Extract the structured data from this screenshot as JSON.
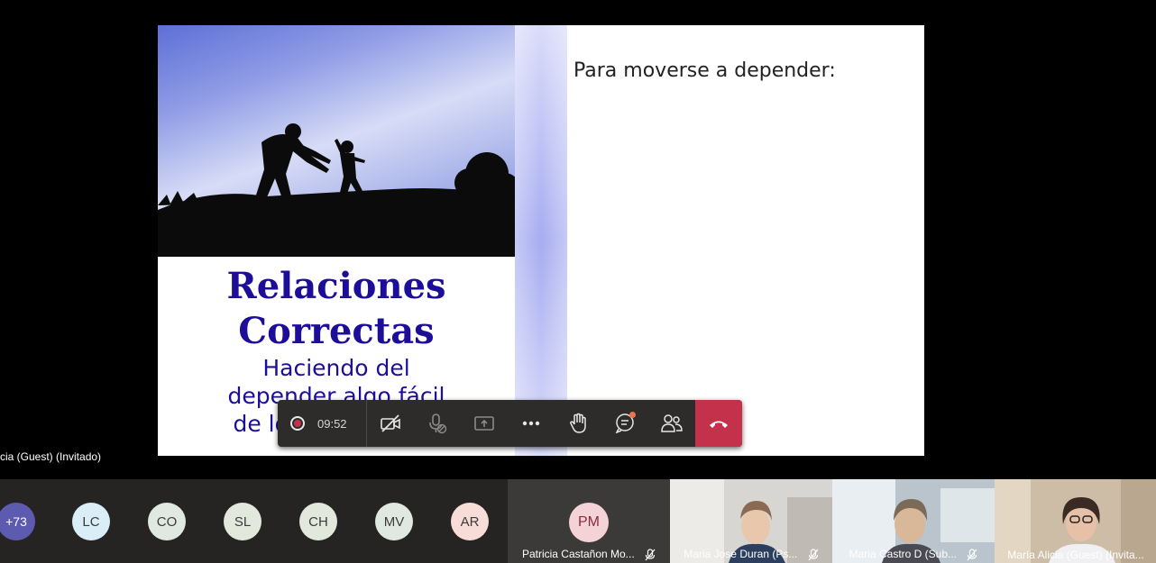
{
  "slide": {
    "caption_line1": "Relaciones",
    "caption_line2": "Correctas",
    "caption_sub1": "Haciendo del",
    "caption_sub2": "depender algo fácil",
    "caption_sub3": "de lograr y seguro",
    "right_heading": "Para moverse a depender:"
  },
  "toolbar": {
    "timer": "09:52",
    "icons": [
      "record-icon",
      "camera-off-icon",
      "mic-off-icon",
      "share-screen-icon",
      "more-icon",
      "raise-hand-icon",
      "chat-icon",
      "participants-icon",
      "hang-up-icon"
    ],
    "chat_has_notification": true
  },
  "presenter_label": "cia (Guest) (Invitado)",
  "participants": [
    {
      "initials": "+73",
      "color": "#5c5bb0"
    },
    {
      "initials": "LC",
      "color": "#d9eef6"
    },
    {
      "initials": "CO",
      "color": "#dfe9e1"
    },
    {
      "initials": "SL",
      "color": "#e2e8dc"
    },
    {
      "initials": "CH",
      "color": "#e2e8dc"
    },
    {
      "initials": "MV",
      "color": "#dfe9e1"
    },
    {
      "initials": "AR",
      "color": "#f8dcd8"
    }
  ],
  "pm_tile": {
    "initials": "PM",
    "name": "Patricia Castañon Mo..."
  },
  "video_tiles": [
    {
      "name": "Maria Jose Duran (Ps..."
    },
    {
      "name": "Maria Castro D (Sub..."
    },
    {
      "name": "María Alicia (Guest) (Invita..."
    }
  ]
}
